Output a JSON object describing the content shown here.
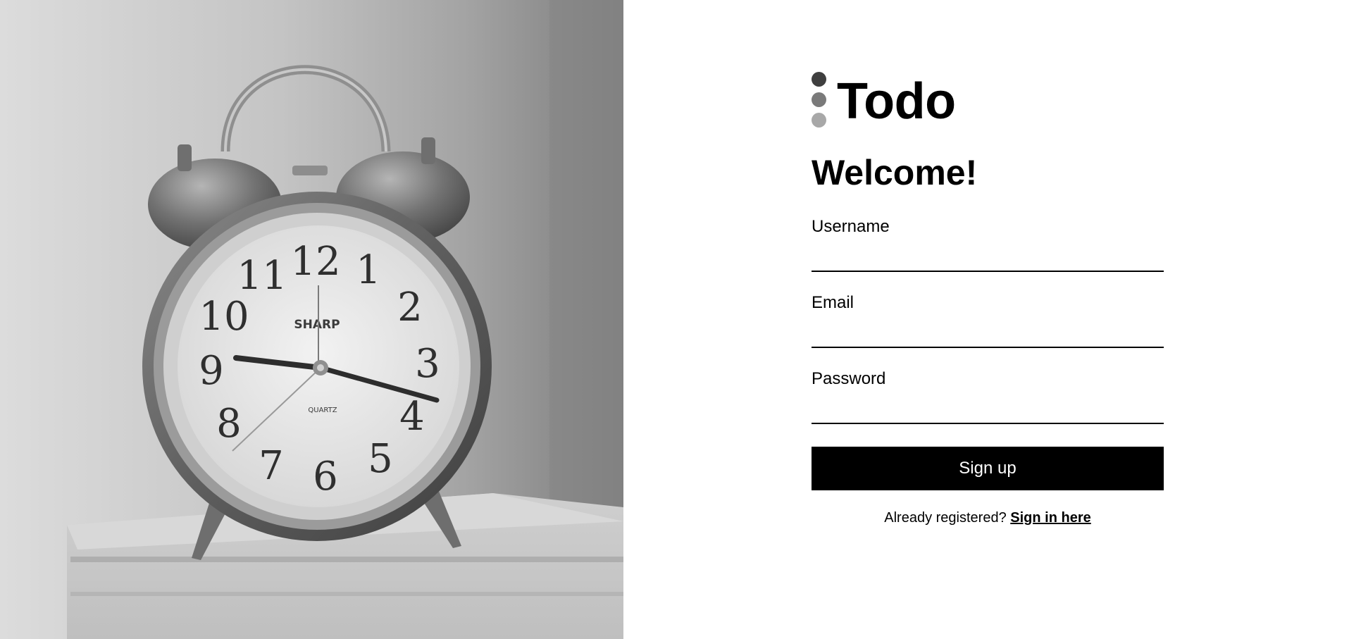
{
  "brand": {
    "name": "Todo",
    "dot_colors": [
      "#3f3f3f",
      "#7a7a7a",
      "#a8a8a8"
    ]
  },
  "hero_image": {
    "icon": "alarm-clock-photo",
    "clock_brand": "SHARP",
    "clock_subtitle": "QUARTZ",
    "numerals": [
      "12",
      "1",
      "2",
      "3",
      "4",
      "5",
      "6",
      "7",
      "8",
      "9",
      "10",
      "11"
    ]
  },
  "form": {
    "heading": "Welcome!",
    "fields": {
      "username": {
        "label": "Username",
        "value": ""
      },
      "email": {
        "label": "Email",
        "value": ""
      },
      "password": {
        "label": "Password",
        "value": ""
      }
    },
    "submit_label": "Sign up",
    "signin_prompt": "Already registered?",
    "signin_link": "Sign in here"
  },
  "colors": {
    "text": "#000000",
    "button_bg": "#000000",
    "button_text": "#ffffff",
    "background": "#ffffff"
  }
}
